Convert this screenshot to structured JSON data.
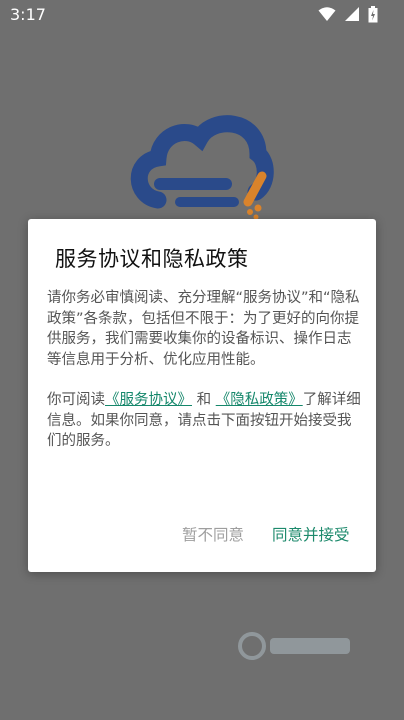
{
  "status_bar": {
    "time": "3:17",
    "icons": [
      "wifi-icon",
      "signal-icon",
      "battery-icon"
    ]
  },
  "dialog": {
    "title": "服务协议和隐私政策",
    "paragraph1": "请你务必审慎阅读、充分理解“服务协议”和“隐私政策”各条款，包括但不限于：为了更好的向你提供服务，我们需要收集你的设备标识、操作日志等信息用于分析、优化应用性能。",
    "paragraph2": {
      "prefix": "你可阅读",
      "link_terms": "《服务协议》",
      "connector": "和",
      "link_privacy": "《隐私政策》",
      "suffix": "了解详细信息。如果你同意，请点击下面按钮开始接受我们的服务。"
    },
    "buttons": {
      "decline": "暂不同意",
      "accept": "同意并接受"
    }
  },
  "colors": {
    "accent": "#1d8a6c",
    "link": "#15876b",
    "overlay_bg": "#6f6f6f",
    "logo_blue": "#2a4a8a",
    "logo_orange": "#d9832b"
  }
}
